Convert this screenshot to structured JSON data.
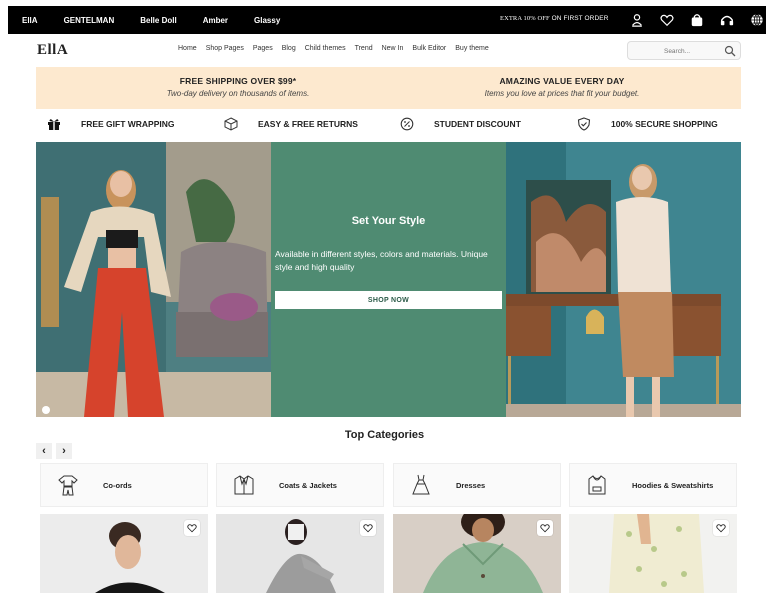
{
  "topbar": {
    "brands": [
      "EllA",
      "GENTELMAN",
      "Belle Doll",
      "Amber",
      "Glassy"
    ],
    "promo_prefix": "EXTRA 10% OFF",
    "promo_suffix": " ON FIRST ORDER",
    "icons": [
      "account-icon",
      "heart-icon",
      "bag-icon",
      "headphones-icon",
      "globe-icon"
    ]
  },
  "header": {
    "logo": "EllA",
    "nav": [
      "Home",
      "Shop Pages",
      "Pages",
      "Blog",
      "Child themes",
      "Trend",
      "New In",
      "Bulk Editor",
      "Buy theme"
    ],
    "search_placeholder": "Search..."
  },
  "shipping": [
    {
      "title": "FREE SHIPPING OVER $99*",
      "subtitle": "Two-day delivery on thousands of items."
    },
    {
      "title": "AMAZING VALUE EVERY DAY",
      "subtitle": "Items you love at prices that fit your budget."
    }
  ],
  "features": [
    {
      "label": "FREE GIFT WRAPPING",
      "icon": "gift-icon"
    },
    {
      "label": "EASY & FREE RETURNS",
      "icon": "box-icon"
    },
    {
      "label": "STUDENT DISCOUNT",
      "icon": "discount-icon"
    },
    {
      "label": "100% SECURE SHOPPING",
      "icon": "shield-icon"
    }
  ],
  "hero": {
    "title": "Set Your Style",
    "description": "Available in different styles, colors and materials. Unique style and high quality",
    "button": "SHOP NOW",
    "panel_color": "#4f8b72"
  },
  "categories": {
    "title": "Top Categories",
    "items": [
      {
        "label": "Co-ords",
        "icon": "co-ords-icon"
      },
      {
        "label": "Coats & Jackets",
        "icon": "jacket-icon"
      },
      {
        "label": "Dresses",
        "icon": "dress-icon"
      },
      {
        "label": "Hoodies & Sweatshirts",
        "icon": "hoodie-icon"
      }
    ]
  },
  "colors": {
    "accent_banner": "#fde9cf",
    "topbar": "#000000"
  }
}
